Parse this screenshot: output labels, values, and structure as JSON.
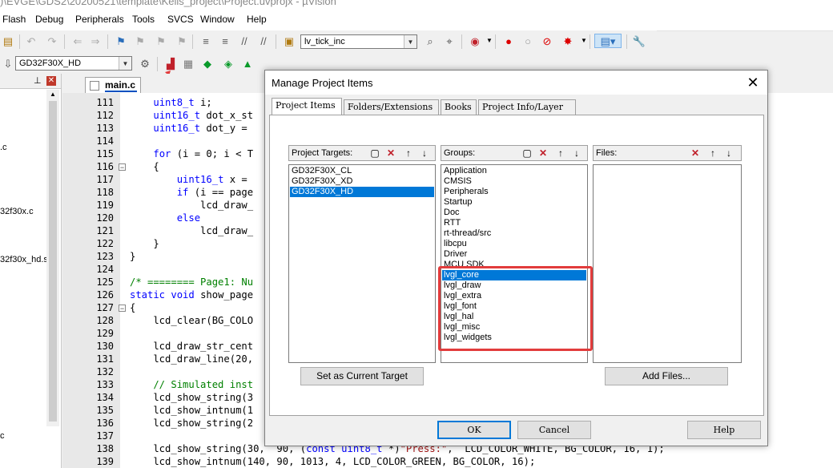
{
  "window_title": ")\\EVGE\\GDS2\\20200521\\template\\Keils_project\\Project.uvprojx - µVision",
  "menu": [
    "Flash",
    "Debug",
    "Peripherals",
    "Tools",
    "SVCS",
    "Window",
    "Help"
  ],
  "toolbar": {
    "target_combo": "lv_tick_inc",
    "target_select": "GD32F30X_HD"
  },
  "left_panel": {
    "items": [
      ".c",
      "32f30x.c",
      "32f30x_hd.s",
      "c"
    ]
  },
  "editor": {
    "tab_label": "main.c",
    "lines": [
      {
        "n": "111",
        "t": "    uint8_t i;"
      },
      {
        "n": "112",
        "t": "    uint16_t dot_x_st"
      },
      {
        "n": "113",
        "t": "    uint16_t dot_y = "
      },
      {
        "n": "114",
        "t": ""
      },
      {
        "n": "115",
        "t": "    for (i = 0; i < T"
      },
      {
        "n": "116",
        "t": "    {"
      },
      {
        "n": "117",
        "t": "        uint16_t x = "
      },
      {
        "n": "118",
        "t": "        if (i == page"
      },
      {
        "n": "119",
        "t": "            lcd_draw_"
      },
      {
        "n": "120",
        "t": "        else"
      },
      {
        "n": "121",
        "t": "            lcd_draw_"
      },
      {
        "n": "122",
        "t": "    }"
      },
      {
        "n": "123",
        "t": "}"
      },
      {
        "n": "124",
        "t": ""
      },
      {
        "n": "125",
        "t": "/* ======== Page1: Nu"
      },
      {
        "n": "126",
        "t": "static void show_page"
      },
      {
        "n": "127",
        "t": "{"
      },
      {
        "n": "128",
        "t": "    lcd_clear(BG_COLO"
      },
      {
        "n": "129",
        "t": ""
      },
      {
        "n": "130",
        "t": "    lcd_draw_str_cent"
      },
      {
        "n": "131",
        "t": "    lcd_draw_line(20,"
      },
      {
        "n": "132",
        "t": ""
      },
      {
        "n": "133",
        "t": "    // Simulated inst"
      },
      {
        "n": "134",
        "t": "    lcd_show_string(3"
      },
      {
        "n": "135",
        "t": "    lcd_show_intnum(1"
      },
      {
        "n": "136",
        "t": "    lcd_show_string(2"
      },
      {
        "n": "137",
        "t": ""
      },
      {
        "n": "138",
        "t": "    lcd_show_string(30,  90, (const uint8_t *)\"Press:\",  LCD_COLOR_WHITE, BG_COLOR, 16, 1);"
      },
      {
        "n": "139",
        "t": "    lcd_show_intnum(140, 90, 1013, 4, LCD_COLOR_GREEN, BG_COLOR, 16);"
      }
    ]
  },
  "dialog": {
    "title": "Manage Project Items",
    "tabs": [
      "Project Items",
      "Folders/Extensions",
      "Books",
      "Project Info/Layer"
    ],
    "targets_label": "Project Targets:",
    "groups_label": "Groups:",
    "files_label": "Files:",
    "targets": [
      "GD32F30X_CL",
      "GD32F30X_XD",
      "GD32F30X_HD"
    ],
    "selected_target": "GD32F30X_HD",
    "groups": [
      "Application",
      "CMSIS",
      "Peripherals",
      "Startup",
      "Doc",
      "RTT",
      "rt-thread/src",
      "libcpu",
      "Driver",
      "MCU SDK",
      "lvgl_core",
      "lvgl_draw",
      "lvgl_extra",
      "lvgl_font",
      "lvgl_hal",
      "lvgl_misc",
      "lvgl_widgets"
    ],
    "selected_group": "lvgl_core",
    "set_current_target": "Set as Current Target",
    "add_files": "Add Files...",
    "ok": "OK",
    "cancel": "Cancel",
    "help": "Help"
  },
  "colors": {
    "selection": "#0078d7",
    "highlight_box": "#e23c3c",
    "keyword": "#0000ff",
    "comment": "#008000"
  }
}
